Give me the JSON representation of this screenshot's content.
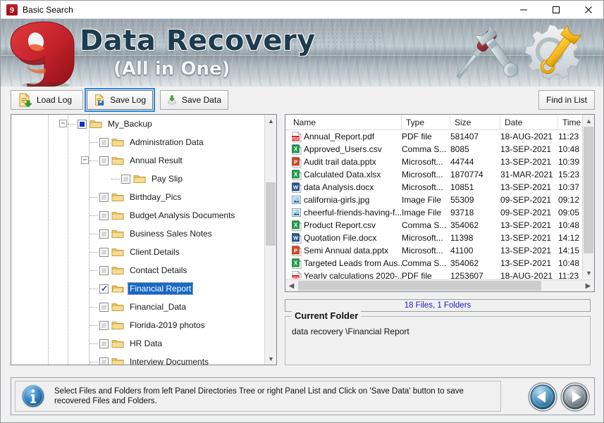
{
  "window": {
    "title": "Basic Search",
    "icon": "app-logo-icon",
    "minimize_label": "Minimize",
    "maximize_label": "Maximize",
    "close_label": "Close"
  },
  "banner": {
    "title": "Data Recovery",
    "subtitle": "(All in One)",
    "logo": "red-nine-logo",
    "art": "tools-screwdriver-wrench-gear"
  },
  "toolbar": {
    "load_log": "Load Log",
    "save_log": "Save Log",
    "save_data": "Save Data",
    "find_in_list": "Find in List",
    "focused_button": "Save Log"
  },
  "tree": {
    "nodes": [
      {
        "label": "My_Backup",
        "depth": 0,
        "check": "blue",
        "expander": "minus",
        "open": false,
        "selected": false
      },
      {
        "label": "Administration Data",
        "depth": 1,
        "check": "grey",
        "expander": "none",
        "open": false,
        "selected": false
      },
      {
        "label": "Annual Result",
        "depth": 1,
        "check": "grey",
        "expander": "minus",
        "open": false,
        "selected": false
      },
      {
        "label": "Pay Slip",
        "depth": 2,
        "check": "grey",
        "expander": "none",
        "open": false,
        "selected": false
      },
      {
        "label": "Birthday_Pics",
        "depth": 1,
        "check": "grey",
        "expander": "none",
        "open": false,
        "selected": false
      },
      {
        "label": "Budget Analysis Documents",
        "depth": 1,
        "check": "grey",
        "expander": "none",
        "open": false,
        "selected": false
      },
      {
        "label": "Business Sales Notes",
        "depth": 1,
        "check": "grey",
        "expander": "none",
        "open": false,
        "selected": false
      },
      {
        "label": "Client Details",
        "depth": 1,
        "check": "grey",
        "expander": "none",
        "open": false,
        "selected": false
      },
      {
        "label": "Contact Details",
        "depth": 1,
        "check": "grey",
        "expander": "none",
        "open": false,
        "selected": false
      },
      {
        "label": "Financial Report",
        "depth": 1,
        "check": "checked",
        "expander": "none",
        "open": true,
        "selected": true
      },
      {
        "label": "Financial_Data",
        "depth": 1,
        "check": "grey",
        "expander": "none",
        "open": false,
        "selected": false
      },
      {
        "label": "Florida-2019 photos",
        "depth": 1,
        "check": "grey",
        "expander": "none",
        "open": false,
        "selected": false
      },
      {
        "label": "HR Data",
        "depth": 1,
        "check": "grey",
        "expander": "none",
        "open": false,
        "selected": false
      },
      {
        "label": "Interview Documents",
        "depth": 1,
        "check": "grey",
        "expander": "none",
        "open": false,
        "selected": false
      }
    ]
  },
  "file_list": {
    "columns": [
      "Name",
      "Type",
      "Size",
      "Date",
      "Time"
    ],
    "rows": [
      {
        "icon": "pdf-file-icon",
        "name": "Annual_Report.pdf",
        "type": "PDF file",
        "size": "581407",
        "date": "18-AUG-2021",
        "time": "11:23"
      },
      {
        "icon": "excel-file-icon",
        "name": "Approved_Users.csv",
        "type": "Comma S...",
        "size": "8085",
        "date": "13-SEP-2021",
        "time": "10:48"
      },
      {
        "icon": "powerpoint-file-icon",
        "name": "Audit trail data.pptx",
        "type": "Microsoft...",
        "size": "44744",
        "date": "13-SEP-2021",
        "time": "10:39"
      },
      {
        "icon": "excel-file-icon",
        "name": "Calculated Data.xlsx",
        "type": "Microsoft...",
        "size": "1870774",
        "date": "31-MAR-2021",
        "time": "15:23"
      },
      {
        "icon": "word-file-icon",
        "name": "data Analysis.docx",
        "type": "Microsoft...",
        "size": "10851",
        "date": "13-SEP-2021",
        "time": "10:37"
      },
      {
        "icon": "image-file-icon",
        "name": "california-girls.jpg",
        "type": "Image File",
        "size": "55309",
        "date": "09-SEP-2021",
        "time": "09:12"
      },
      {
        "icon": "image-file-icon",
        "name": "cheerful-friends-having-f...",
        "type": "Image File",
        "size": "93718",
        "date": "09-SEP-2021",
        "time": "09:05"
      },
      {
        "icon": "excel-file-icon",
        "name": "Product Report.csv",
        "type": "Comma S...",
        "size": "354062",
        "date": "13-SEP-2021",
        "time": "10:48"
      },
      {
        "icon": "word-file-icon",
        "name": "Quotation File.docx",
        "type": "Microsoft...",
        "size": "11398",
        "date": "13-SEP-2021",
        "time": "14:12"
      },
      {
        "icon": "powerpoint-file-icon",
        "name": "Semi Annual data.pptx",
        "type": "Microsoft...",
        "size": "41100",
        "date": "13-SEP-2021",
        "time": "14:15"
      },
      {
        "icon": "excel-file-icon",
        "name": "Targeted Leads from Aus...",
        "type": "Comma S...",
        "size": "354062",
        "date": "13-SEP-2021",
        "time": "10:48"
      },
      {
        "icon": "pdf-file-icon",
        "name": "Yearly calculations 2020-...",
        "type": "PDF file",
        "size": "1253607",
        "date": "18-AUG-2021",
        "time": "11:23"
      }
    ]
  },
  "count_bar": {
    "text": "18 Files,  1 Folders"
  },
  "current_folder": {
    "legend": "Current Folder",
    "path": "data recovery \\Financial Report"
  },
  "status": {
    "icon": "info-icon",
    "message": "Select Files and Folders from left Panel Directories Tree or right Panel List and Click on 'Save Data' button to save recovered Files and Folders.",
    "back_label": "Back",
    "forward_label": "Next"
  },
  "colors": {
    "banner_title": "#1d3c4e",
    "selection": "#1569c7",
    "count_text": "#1b1bc8",
    "logo_red": "#c0202a",
    "focus_outline": "#2a8ada"
  }
}
